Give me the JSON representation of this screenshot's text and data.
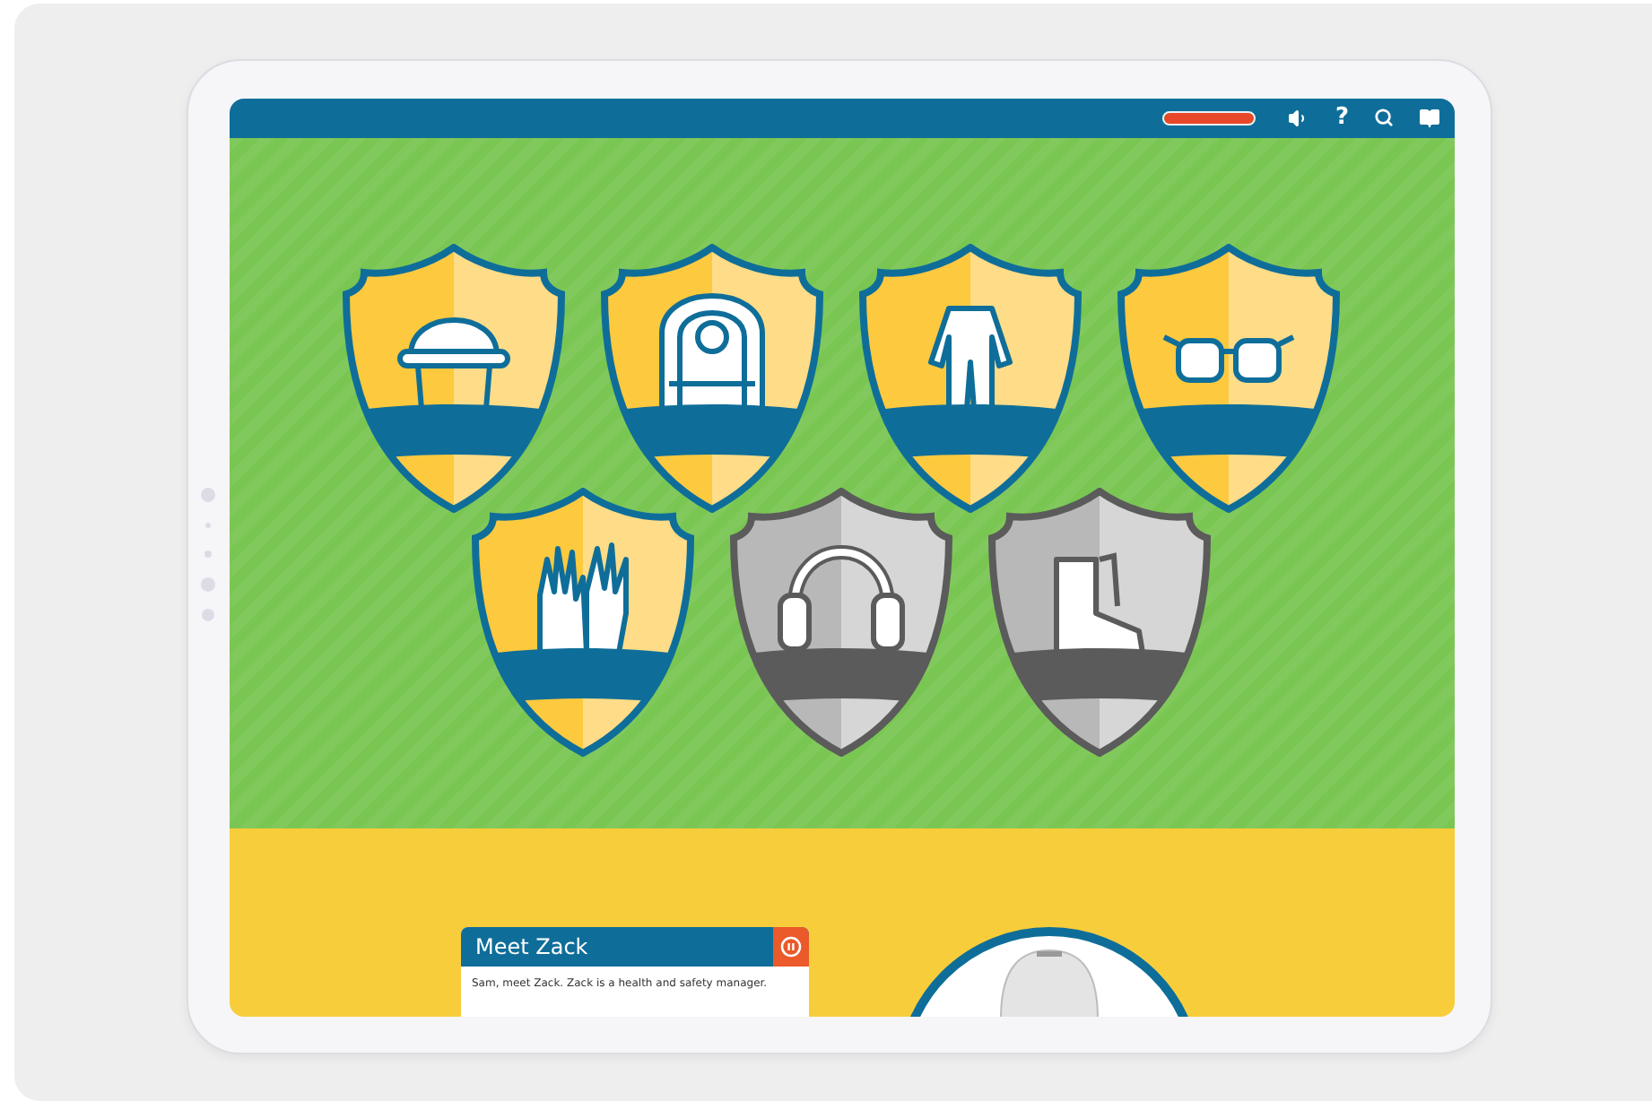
{
  "top_bar": {
    "progress": {
      "level": 1.0
    },
    "help": "?"
  },
  "badges": [
    {
      "kind": "hardhat",
      "earned": true
    },
    {
      "kind": "vest",
      "earned": true
    },
    {
      "kind": "coverall",
      "earned": true
    },
    {
      "kind": "goggles",
      "earned": true
    },
    {
      "kind": "gloves",
      "earned": true
    },
    {
      "kind": "earmuffs",
      "earned": false
    },
    {
      "kind": "boots",
      "earned": false
    }
  ],
  "dialog": {
    "title": "Meet Zack",
    "text": "Sam, meet Zack. Zack is a health and safety manager.",
    "paused": false
  }
}
